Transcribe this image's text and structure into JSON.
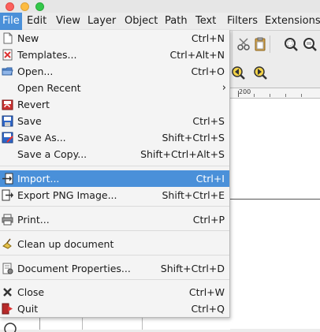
{
  "menubar": {
    "items": [
      "File",
      "Edit",
      "View",
      "Layer",
      "Object",
      "Path",
      "Text",
      "Filters",
      "Extensions"
    ]
  },
  "file_menu": {
    "items": [
      {
        "label": "New",
        "shortcut": "Ctrl+N",
        "icon": "new-document-icon"
      },
      {
        "label": "Templates...",
        "shortcut": "Ctrl+Alt+N",
        "icon": "templates-icon"
      },
      {
        "label": "Open...",
        "shortcut": "Ctrl+O",
        "icon": "open-folder-icon"
      },
      {
        "label": "Open Recent",
        "shortcut": "",
        "icon": ""
      },
      {
        "label": "Revert",
        "shortcut": "",
        "icon": "revert-icon"
      },
      {
        "label": "Save",
        "shortcut": "Ctrl+S",
        "icon": "save-icon"
      },
      {
        "label": "Save As...",
        "shortcut": "Shift+Ctrl+S",
        "icon": "save-as-icon"
      },
      {
        "label": "Save a Copy...",
        "shortcut": "Shift+Ctrl+Alt+S",
        "icon": ""
      },
      {
        "label": "Import...",
        "shortcut": "Ctrl+I",
        "icon": "import-icon"
      },
      {
        "label": "Export PNG Image...",
        "shortcut": "Shift+Ctrl+E",
        "icon": "export-icon"
      },
      {
        "label": "Print...",
        "shortcut": "Ctrl+P",
        "icon": "print-icon"
      },
      {
        "label": "Clean up document",
        "shortcut": "",
        "icon": "clean-up-icon"
      },
      {
        "label": "Document Properties...",
        "shortcut": "Shift+Ctrl+D",
        "icon": "document-properties-icon"
      },
      {
        "label": "Close",
        "shortcut": "Ctrl+W",
        "icon": "close-icon"
      },
      {
        "label": "Quit",
        "shortcut": "Ctrl+Q",
        "icon": "quit-icon"
      }
    ],
    "submenu_arrow": "›"
  },
  "ruler": {
    "label": "200"
  },
  "colors": {
    "highlight": "#4a90d9",
    "menu_bg": "#f4f4f4"
  }
}
